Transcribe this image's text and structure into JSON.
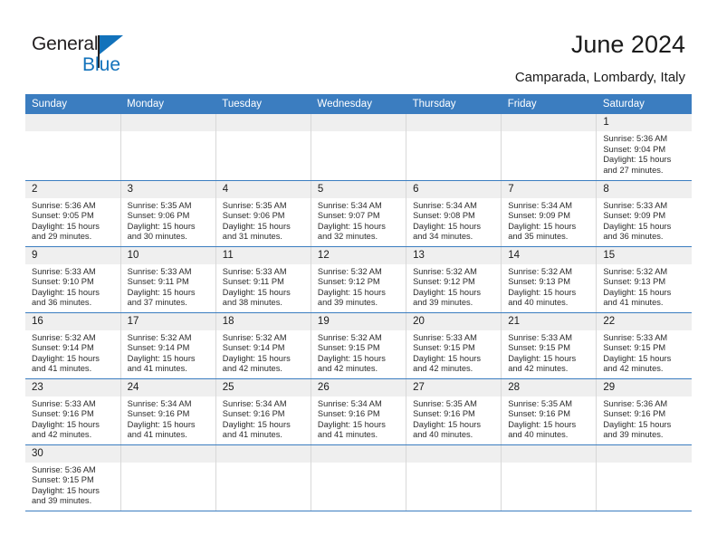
{
  "brand": {
    "name_top": "General",
    "name_bottom": "Blue",
    "flag_color": "#1272bb",
    "text_color": "#231f20"
  },
  "header": {
    "title": "June 2024",
    "subtitle": "Camparada, Lombardy, Italy",
    "header_bg": "#3b7dc0",
    "daynum_bg": "#efefef"
  },
  "weekdays": [
    "Sunday",
    "Monday",
    "Tuesday",
    "Wednesday",
    "Thursday",
    "Friday",
    "Saturday"
  ],
  "labels": {
    "sunrise": "Sunrise:",
    "sunset": "Sunset:",
    "daylight": "Daylight:"
  },
  "weeks": [
    [
      {
        "day": "",
        "empty": true
      },
      {
        "day": "",
        "empty": true
      },
      {
        "day": "",
        "empty": true
      },
      {
        "day": "",
        "empty": true
      },
      {
        "day": "",
        "empty": true
      },
      {
        "day": "",
        "empty": true
      },
      {
        "day": "1",
        "sunrise": "Sunrise: 5:36 AM",
        "sunset": "Sunset: 9:04 PM",
        "daylight": "Daylight: 15 hours and 27 minutes."
      }
    ],
    [
      {
        "day": "2",
        "sunrise": "Sunrise: 5:36 AM",
        "sunset": "Sunset: 9:05 PM",
        "daylight": "Daylight: 15 hours and 29 minutes."
      },
      {
        "day": "3",
        "sunrise": "Sunrise: 5:35 AM",
        "sunset": "Sunset: 9:06 PM",
        "daylight": "Daylight: 15 hours and 30 minutes."
      },
      {
        "day": "4",
        "sunrise": "Sunrise: 5:35 AM",
        "sunset": "Sunset: 9:06 PM",
        "daylight": "Daylight: 15 hours and 31 minutes."
      },
      {
        "day": "5",
        "sunrise": "Sunrise: 5:34 AM",
        "sunset": "Sunset: 9:07 PM",
        "daylight": "Daylight: 15 hours and 32 minutes."
      },
      {
        "day": "6",
        "sunrise": "Sunrise: 5:34 AM",
        "sunset": "Sunset: 9:08 PM",
        "daylight": "Daylight: 15 hours and 34 minutes."
      },
      {
        "day": "7",
        "sunrise": "Sunrise: 5:34 AM",
        "sunset": "Sunset: 9:09 PM",
        "daylight": "Daylight: 15 hours and 35 minutes."
      },
      {
        "day": "8",
        "sunrise": "Sunrise: 5:33 AM",
        "sunset": "Sunset: 9:09 PM",
        "daylight": "Daylight: 15 hours and 36 minutes."
      }
    ],
    [
      {
        "day": "9",
        "sunrise": "Sunrise: 5:33 AM",
        "sunset": "Sunset: 9:10 PM",
        "daylight": "Daylight: 15 hours and 36 minutes."
      },
      {
        "day": "10",
        "sunrise": "Sunrise: 5:33 AM",
        "sunset": "Sunset: 9:11 PM",
        "daylight": "Daylight: 15 hours and 37 minutes."
      },
      {
        "day": "11",
        "sunrise": "Sunrise: 5:33 AM",
        "sunset": "Sunset: 9:11 PM",
        "daylight": "Daylight: 15 hours and 38 minutes."
      },
      {
        "day": "12",
        "sunrise": "Sunrise: 5:32 AM",
        "sunset": "Sunset: 9:12 PM",
        "daylight": "Daylight: 15 hours and 39 minutes."
      },
      {
        "day": "13",
        "sunrise": "Sunrise: 5:32 AM",
        "sunset": "Sunset: 9:12 PM",
        "daylight": "Daylight: 15 hours and 39 minutes."
      },
      {
        "day": "14",
        "sunrise": "Sunrise: 5:32 AM",
        "sunset": "Sunset: 9:13 PM",
        "daylight": "Daylight: 15 hours and 40 minutes."
      },
      {
        "day": "15",
        "sunrise": "Sunrise: 5:32 AM",
        "sunset": "Sunset: 9:13 PM",
        "daylight": "Daylight: 15 hours and 41 minutes."
      }
    ],
    [
      {
        "day": "16",
        "sunrise": "Sunrise: 5:32 AM",
        "sunset": "Sunset: 9:14 PM",
        "daylight": "Daylight: 15 hours and 41 minutes."
      },
      {
        "day": "17",
        "sunrise": "Sunrise: 5:32 AM",
        "sunset": "Sunset: 9:14 PM",
        "daylight": "Daylight: 15 hours and 41 minutes."
      },
      {
        "day": "18",
        "sunrise": "Sunrise: 5:32 AM",
        "sunset": "Sunset: 9:14 PM",
        "daylight": "Daylight: 15 hours and 42 minutes."
      },
      {
        "day": "19",
        "sunrise": "Sunrise: 5:32 AM",
        "sunset": "Sunset: 9:15 PM",
        "daylight": "Daylight: 15 hours and 42 minutes."
      },
      {
        "day": "20",
        "sunrise": "Sunrise: 5:33 AM",
        "sunset": "Sunset: 9:15 PM",
        "daylight": "Daylight: 15 hours and 42 minutes."
      },
      {
        "day": "21",
        "sunrise": "Sunrise: 5:33 AM",
        "sunset": "Sunset: 9:15 PM",
        "daylight": "Daylight: 15 hours and 42 minutes."
      },
      {
        "day": "22",
        "sunrise": "Sunrise: 5:33 AM",
        "sunset": "Sunset: 9:15 PM",
        "daylight": "Daylight: 15 hours and 42 minutes."
      }
    ],
    [
      {
        "day": "23",
        "sunrise": "Sunrise: 5:33 AM",
        "sunset": "Sunset: 9:16 PM",
        "daylight": "Daylight: 15 hours and 42 minutes."
      },
      {
        "day": "24",
        "sunrise": "Sunrise: 5:34 AM",
        "sunset": "Sunset: 9:16 PM",
        "daylight": "Daylight: 15 hours and 41 minutes."
      },
      {
        "day": "25",
        "sunrise": "Sunrise: 5:34 AM",
        "sunset": "Sunset: 9:16 PM",
        "daylight": "Daylight: 15 hours and 41 minutes."
      },
      {
        "day": "26",
        "sunrise": "Sunrise: 5:34 AM",
        "sunset": "Sunset: 9:16 PM",
        "daylight": "Daylight: 15 hours and 41 minutes."
      },
      {
        "day": "27",
        "sunrise": "Sunrise: 5:35 AM",
        "sunset": "Sunset: 9:16 PM",
        "daylight": "Daylight: 15 hours and 40 minutes."
      },
      {
        "day": "28",
        "sunrise": "Sunrise: 5:35 AM",
        "sunset": "Sunset: 9:16 PM",
        "daylight": "Daylight: 15 hours and 40 minutes."
      },
      {
        "day": "29",
        "sunrise": "Sunrise: 5:36 AM",
        "sunset": "Sunset: 9:16 PM",
        "daylight": "Daylight: 15 hours and 39 minutes."
      }
    ],
    [
      {
        "day": "30",
        "sunrise": "Sunrise: 5:36 AM",
        "sunset": "Sunset: 9:15 PM",
        "daylight": "Daylight: 15 hours and 39 minutes."
      },
      {
        "day": "",
        "empty": true
      },
      {
        "day": "",
        "empty": true
      },
      {
        "day": "",
        "empty": true
      },
      {
        "day": "",
        "empty": true
      },
      {
        "day": "",
        "empty": true
      },
      {
        "day": "",
        "empty": true
      }
    ]
  ]
}
